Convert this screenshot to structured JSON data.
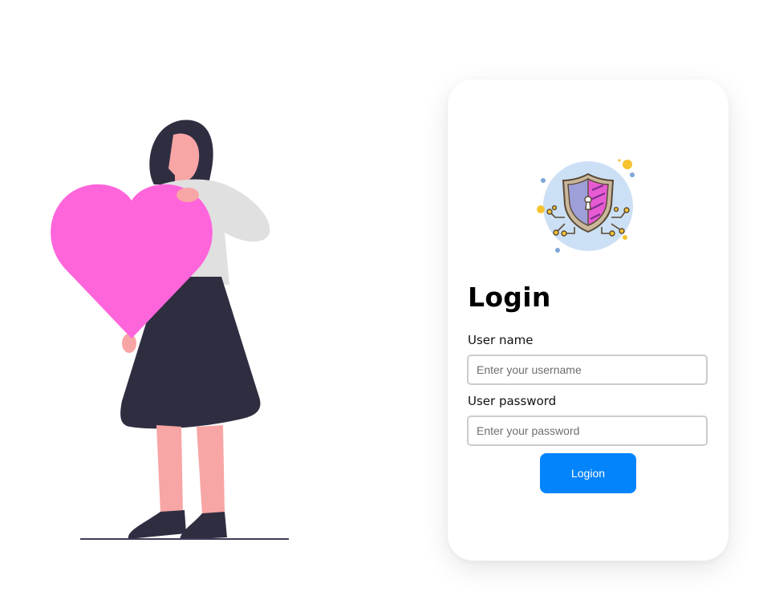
{
  "login": {
    "title": "Login",
    "username_label": "User name",
    "username_value": "",
    "username_placeholder": "Enter your username",
    "password_label": "User password",
    "password_value": "",
    "password_placeholder": "Enter your password",
    "submit_label": "Logion"
  },
  "icons": {
    "illustration": "woman-holding-heart-illustration",
    "emblem": "security-shield-icon"
  },
  "colors": {
    "accent": "#0484fb",
    "heart": "#ff65db",
    "dark": "#2f2e41",
    "skin": "#f8a5a5",
    "shirt": "#e0e0e0",
    "emblem_circle": "#cce0f5",
    "shield_stripe": "#e75bd2",
    "shield_body": "#9e9fd8",
    "dot_yellow": "#f5c330",
    "dot_blue": "#7fa6d8"
  }
}
